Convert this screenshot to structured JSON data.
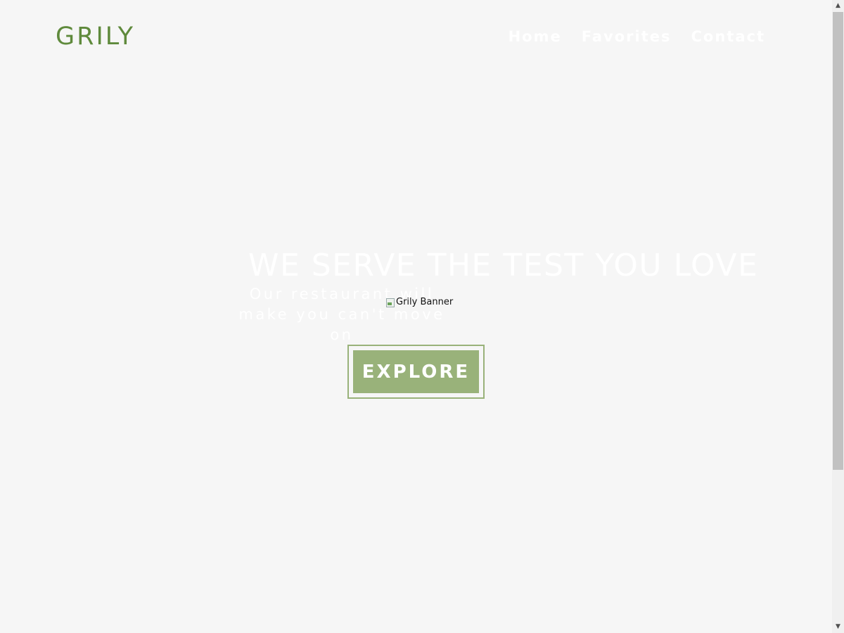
{
  "header": {
    "logo": "GRILY",
    "nav": [
      "Home",
      "Favorites",
      "Contact"
    ]
  },
  "hero": {
    "title": "WE SERVE THE TEST YOU LOVE",
    "subtitle": "Our restaurant will make you can't move on",
    "banner_alt": "Grily Banner",
    "button_label": "EXPLORE"
  },
  "scrollbar": {
    "up_icon": "chevron-up-icon",
    "down_icon": "chevron-down-icon"
  },
  "colors": {
    "brand": "#5f8a3c",
    "button": "#99b27a",
    "background": "#f6f6f6",
    "text_light": "#ffffff"
  }
}
